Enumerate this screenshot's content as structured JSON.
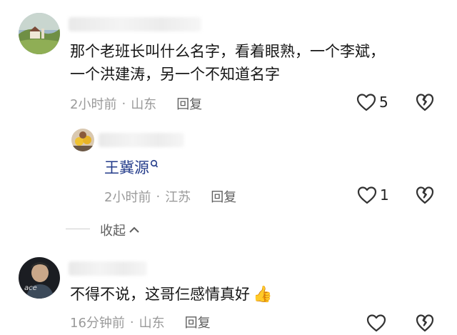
{
  "comments": [
    {
      "text_line1": "那个老班长叫什么名字，看着眼熟，一个李斌，",
      "text_line2": "一个洪建涛，另一个不知道名字",
      "time": "2小时前",
      "dot": "·",
      "location": "山东",
      "reply_label": "回复",
      "like_count": "5"
    },
    {
      "text": "不得不说，这哥仨感情真好",
      "emoji": "👍",
      "time": "16分钟前",
      "dot": "·",
      "location": "山东",
      "reply_label": "回复"
    }
  ],
  "reply": {
    "mention": "王冀源",
    "time": "2小时前",
    "dot": "·",
    "location": "江苏",
    "reply_label": "回复",
    "like_count": "1"
  },
  "collapse_label": "收起",
  "icons": {
    "like": "heart-outline-icon",
    "dislike": "broken-heart-icon",
    "collapse": "chevron-up-icon",
    "mention_tag": "search-q-icon"
  },
  "colors": {
    "meta_gray": "#9a9a9a",
    "mention_blue": "#233b8a"
  }
}
